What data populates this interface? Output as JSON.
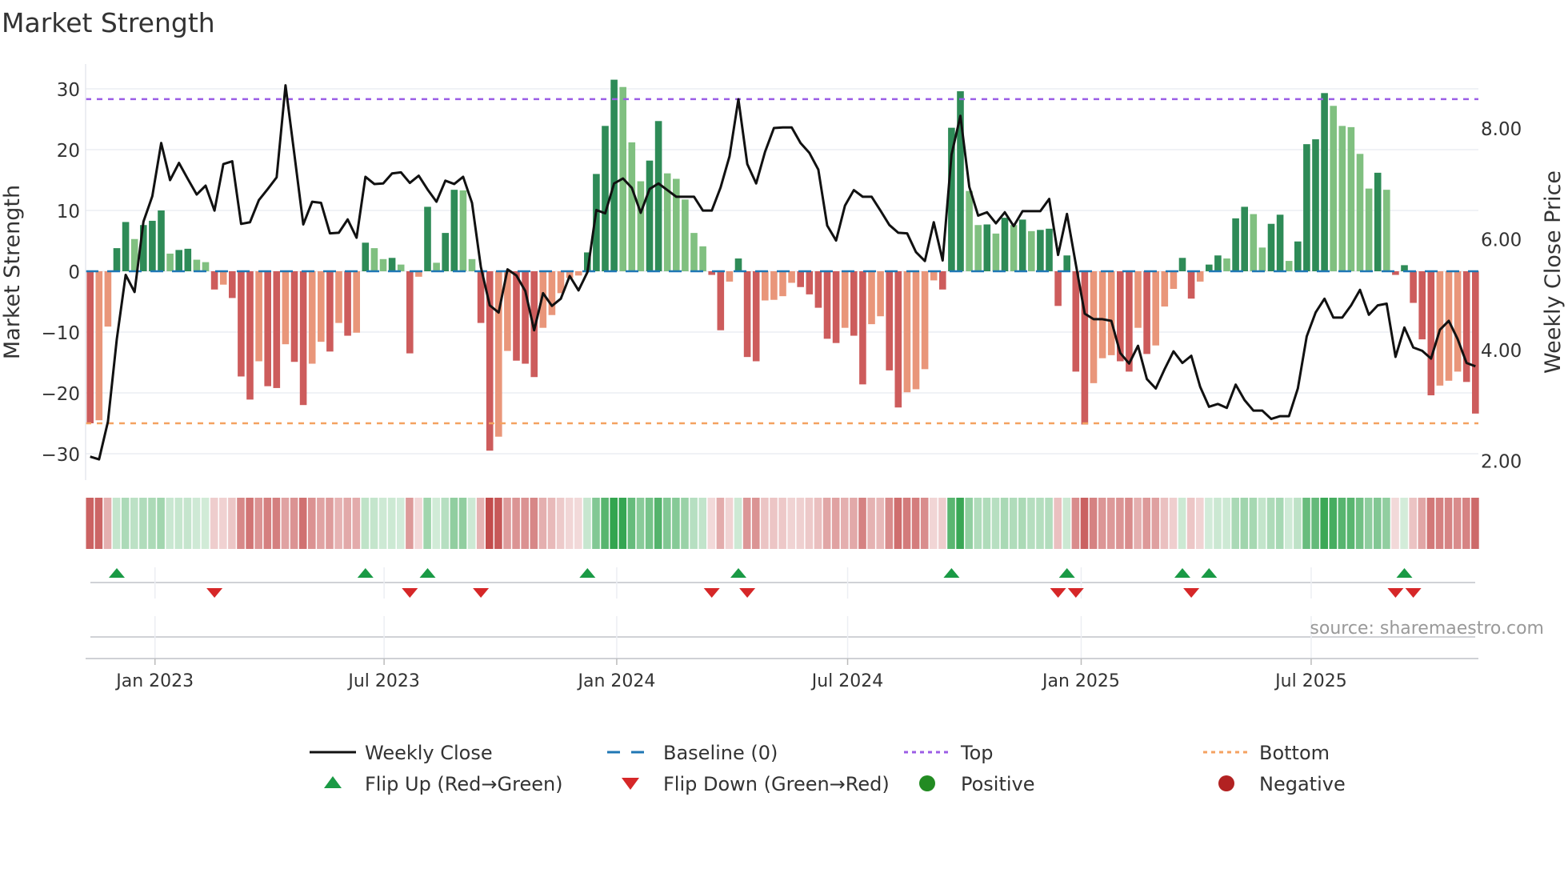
{
  "chart_data": {
    "type": "bar",
    "title": "Market Strength",
    "ylabel": "Market Strength",
    "y2label": "Weekly Close Price",
    "ylim": [
      -32,
      34
    ],
    "y2lim": [
      1.8,
      9.0
    ],
    "yticks": [
      -30,
      -20,
      -10,
      0,
      10,
      20,
      30
    ],
    "ytick_labels": [
      "−30",
      "−20",
      "−10",
      "0",
      "10",
      "20",
      "30"
    ],
    "y2ticks": [
      2,
      4,
      6,
      8
    ],
    "y2tick_labels": [
      "2.00",
      "4.00",
      "6.00",
      "8.00"
    ],
    "x_unit": "week index",
    "xticks": [
      {
        "week": 7.3,
        "label": "Jan 2023"
      },
      {
        "week": 33.1,
        "label": "Jul 2023"
      },
      {
        "week": 59.3,
        "label": "Jan 2024"
      },
      {
        "week": 85.3,
        "label": "Jul 2024"
      },
      {
        "week": 111.6,
        "label": "Jan 2025"
      },
      {
        "week": 137.5,
        "label": "Jul 2025"
      }
    ],
    "top_level": 28.3,
    "bottom_level": -25,
    "baseline": 0,
    "strength": [
      -25.0,
      -24.5,
      -9.1,
      3.8,
      8.1,
      5.3,
      7.6,
      8.3,
      10.0,
      2.9,
      3.5,
      3.7,
      1.9,
      1.5,
      -3.0,
      -2.2,
      -4.4,
      -17.3,
      -21.1,
      -14.8,
      -18.9,
      -19.2,
      -12.0,
      -14.9,
      -22.0,
      -15.2,
      -11.6,
      -13.2,
      -8.5,
      -10.6,
      -10.1,
      4.7,
      3.8,
      2.0,
      2.2,
      1.1,
      -13.5,
      -0.9,
      10.6,
      1.4,
      6.3,
      13.4,
      13.3,
      2.0,
      -8.5,
      -29.5,
      -27.2,
      -13.1,
      -14.7,
      -15.2,
      -17.4,
      -9.3,
      -7.2,
      -3.6,
      -1.1,
      -0.7,
      3.1,
      16.0,
      23.9,
      31.5,
      30.3,
      21.2,
      14.8,
      18.2,
      24.7,
      16.1,
      15.2,
      11.8,
      6.3,
      4.1,
      -0.6,
      -9.7,
      -1.7,
      2.1,
      -14.1,
      -14.8,
      -4.8,
      -4.7,
      -4.1,
      -1.9,
      -2.6,
      -3.8,
      -6.0,
      -11.1,
      -11.8,
      -9.3,
      -10.6,
      -18.6,
      -8.7,
      -7.4,
      -16.3,
      -22.4,
      -19.9,
      -19.4,
      -16.1,
      -1.5,
      -3.0,
      23.6,
      29.6,
      13.2,
      7.6,
      7.7,
      6.2,
      8.8,
      7.6,
      8.5,
      6.6,
      6.8,
      7.0,
      -5.7,
      2.6,
      -16.5,
      -25.2,
      -18.4,
      -14.3,
      -13.8,
      -14.8,
      -16.5,
      -9.3,
      -13.6,
      -12.2,
      -5.8,
      -2.9,
      2.2,
      -4.5,
      -1.7,
      1.1,
      2.6,
      2.1,
      8.7,
      10.6,
      9.4,
      3.9,
      7.8,
      9.3,
      1.7,
      4.9,
      20.9,
      21.7,
      29.3,
      27.2,
      23.9,
      23.7,
      19.3,
      13.6,
      16.2,
      13.4,
      -0.6,
      1.0,
      -5.2,
      -11.2,
      -20.4,
      -18.8,
      -18.0,
      -16.5,
      -18.2,
      -23.4
    ],
    "weekly_close": [
      2.07,
      2.02,
      2.7,
      4.19,
      5.35,
      5.04,
      6.31,
      6.77,
      7.73,
      7.06,
      7.37,
      7.08,
      6.8,
      6.96,
      6.51,
      7.35,
      7.4,
      6.27,
      6.3,
      6.7,
      6.9,
      7.11,
      8.77,
      7.52,
      6.26,
      6.67,
      6.65,
      6.1,
      6.11,
      6.35,
      6.02,
      7.12,
      6.99,
      7.0,
      7.18,
      7.2,
      7.01,
      7.14,
      6.89,
      6.67,
      7.05,
      6.99,
      7.12,
      6.65,
      5.49,
      4.8,
      4.67,
      5.45,
      5.34,
      5.06,
      4.35,
      5.02,
      4.79,
      4.92,
      5.33,
      5.07,
      5.4,
      6.52,
      6.46,
      7.0,
      7.09,
      6.92,
      6.47,
      6.9,
      7.0,
      6.88,
      6.76,
      6.76,
      6.76,
      6.51,
      6.51,
      6.93,
      7.49,
      8.52,
      7.35,
      7.0,
      7.57,
      8.0,
      8.01,
      8.01,
      7.73,
      7.55,
      7.25,
      6.24,
      5.97,
      6.6,
      6.88,
      6.76,
      6.76,
      6.51,
      6.25,
      6.11,
      6.1,
      5.76,
      5.6,
      6.3,
      5.61,
      7.52,
      8.22,
      6.94,
      6.42,
      6.48,
      6.28,
      6.48,
      6.23,
      6.5,
      6.5,
      6.5,
      6.72,
      5.71,
      6.45,
      5.54,
      4.65,
      4.55,
      4.55,
      4.52,
      3.94,
      3.75,
      4.07,
      3.47,
      3.3,
      3.65,
      3.97,
      3.76,
      3.89,
      3.33,
      2.97,
      3.02,
      2.95,
      3.37,
      3.09,
      2.9,
      2.9,
      2.75,
      2.8,
      2.8,
      3.3,
      4.24,
      4.67,
      4.92,
      4.58,
      4.58,
      4.8,
      5.08,
      4.63,
      4.8,
      4.83,
      3.87,
      4.4,
      4.04,
      3.98,
      3.84,
      4.36,
      4.52,
      4.19,
      3.76,
      3.7
    ],
    "legend": [
      {
        "label": "Weekly Close",
        "type": "line"
      },
      {
        "label": "Baseline (0)",
        "type": "dashed"
      },
      {
        "label": "Top",
        "type": "dotted"
      },
      {
        "label": "Bottom",
        "type": "dotted"
      },
      {
        "label": "Flip Up (Red→Green)",
        "type": "triangle-up"
      },
      {
        "label": "Flip Down (Green→Red)",
        "type": "triangle-down"
      },
      {
        "label": "Positive",
        "type": "circle"
      },
      {
        "label": "Negative",
        "type": "circle"
      }
    ],
    "legend_position": "bottom",
    "grid": true,
    "source": "source: sharemaestro.com",
    "colors": {
      "pos_dark": "#2e8b57",
      "pos_light": "#80c080",
      "neg_dark": "#cd5c5c",
      "neg_light": "#e9967a",
      "line": "#111111",
      "baseline": "#1f77b4",
      "top": "#9b5de5",
      "bottom": "#f4a261",
      "flip_up": "#1a9a45",
      "flip_down": "#d62728",
      "positive": "#228b22",
      "negative": "#b22222"
    }
  }
}
